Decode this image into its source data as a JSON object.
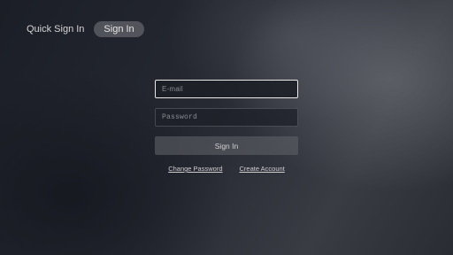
{
  "header": {
    "tabs": [
      {
        "label": "Quick Sign In",
        "active": false
      },
      {
        "label": "Sign In",
        "active": true
      }
    ]
  },
  "form": {
    "email": {
      "placeholder": "E-mail",
      "value": ""
    },
    "password": {
      "placeholder": "Password",
      "value": ""
    },
    "submit_label": "Sign In"
  },
  "links": {
    "change_password": "Change Password",
    "create_account": "Create Account"
  },
  "colors": {
    "focus_border": "#e9e9ea",
    "text": "#d8d8d8"
  }
}
